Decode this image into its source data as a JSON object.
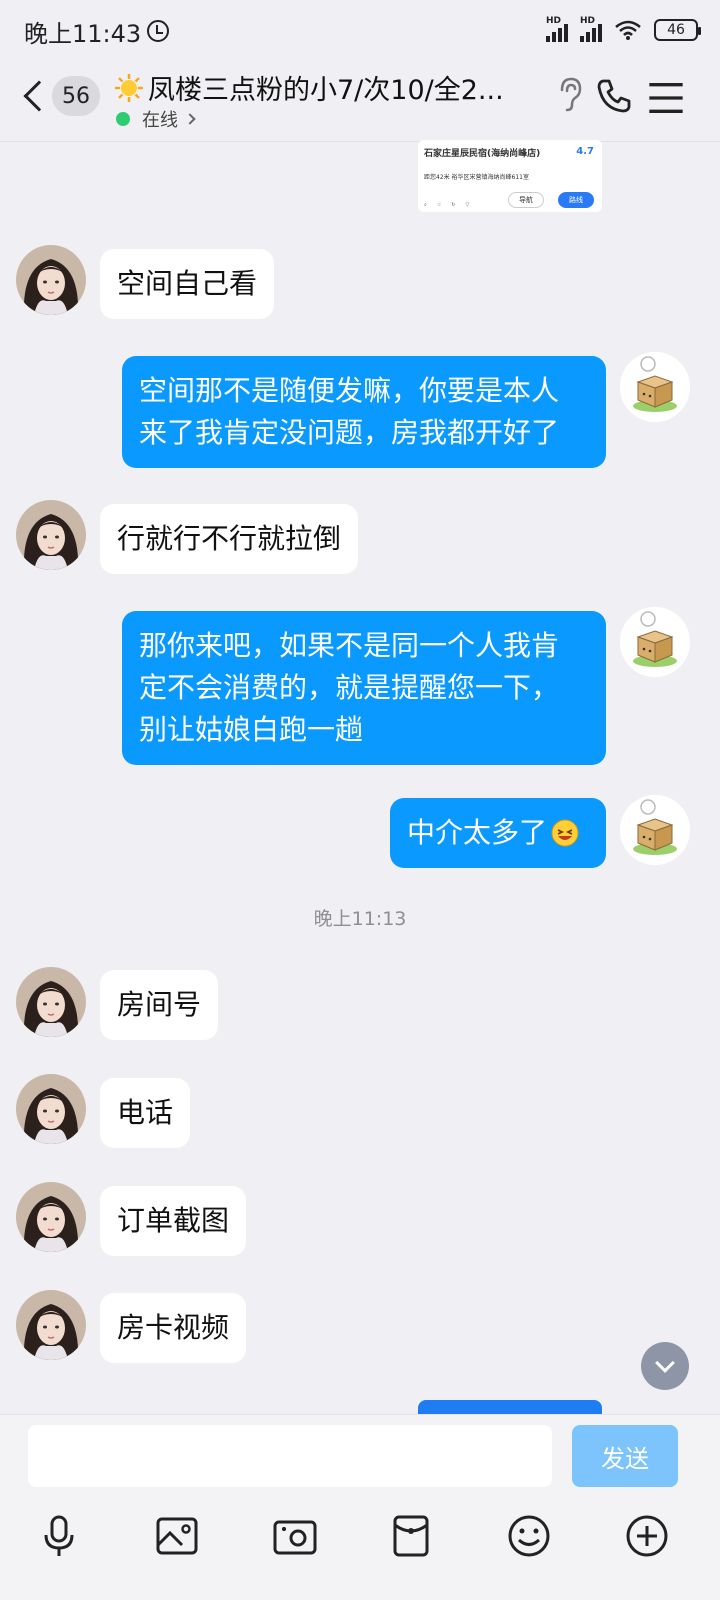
{
  "status_bar": {
    "time": "晚上11:43",
    "hd1": "HD",
    "hd2": "HD",
    "battery": "46"
  },
  "header": {
    "unread_count": "56",
    "title": "凤楼三点粉的小7/次10/全2...",
    "status": "在线"
  },
  "shared_card": {
    "hotel_name": "石家庄星辰民宿(海纳尚峰店)",
    "rating": "4.7",
    "address": "距您42米  裕华区宋营镇海纳尚峰611室",
    "nav_label": "导航",
    "route_label": "路线"
  },
  "messages": [
    {
      "side": "left",
      "text": "空间自己看"
    },
    {
      "side": "right",
      "lines": [
        "空间那不是随便发嘛，你要是本人",
        "来了我肯定没问题，房我都开好了"
      ]
    },
    {
      "side": "left",
      "text": "行就行不行就拉倒"
    },
    {
      "side": "right",
      "lines": [
        "那你来吧，如果不是同一个人我肯",
        "定不会消费的，就是提醒您一下，",
        "别让姑娘白跑一趟"
      ]
    },
    {
      "side": "right",
      "text": "中介太多了"
    },
    {
      "side": "left",
      "text": "房间号"
    },
    {
      "side": "left",
      "text": "电话"
    },
    {
      "side": "left",
      "text": "订单截图"
    },
    {
      "side": "left",
      "text": "房卡视频"
    }
  ],
  "time_divider": "晚上11:13",
  "input": {
    "placeholder": "",
    "send_label": "发送"
  },
  "toolbar": {
    "icons": [
      "microphone-icon",
      "image-icon",
      "camera-icon",
      "red-packet-icon",
      "emoji-icon",
      "plus-icon"
    ]
  },
  "colors": {
    "bubble_outgoing": "#0a99ff",
    "bubble_incoming": "#ffffff",
    "background": "#f0f0f4",
    "send_button": "#7cc4fb",
    "online_dot": "#2ecc71"
  }
}
